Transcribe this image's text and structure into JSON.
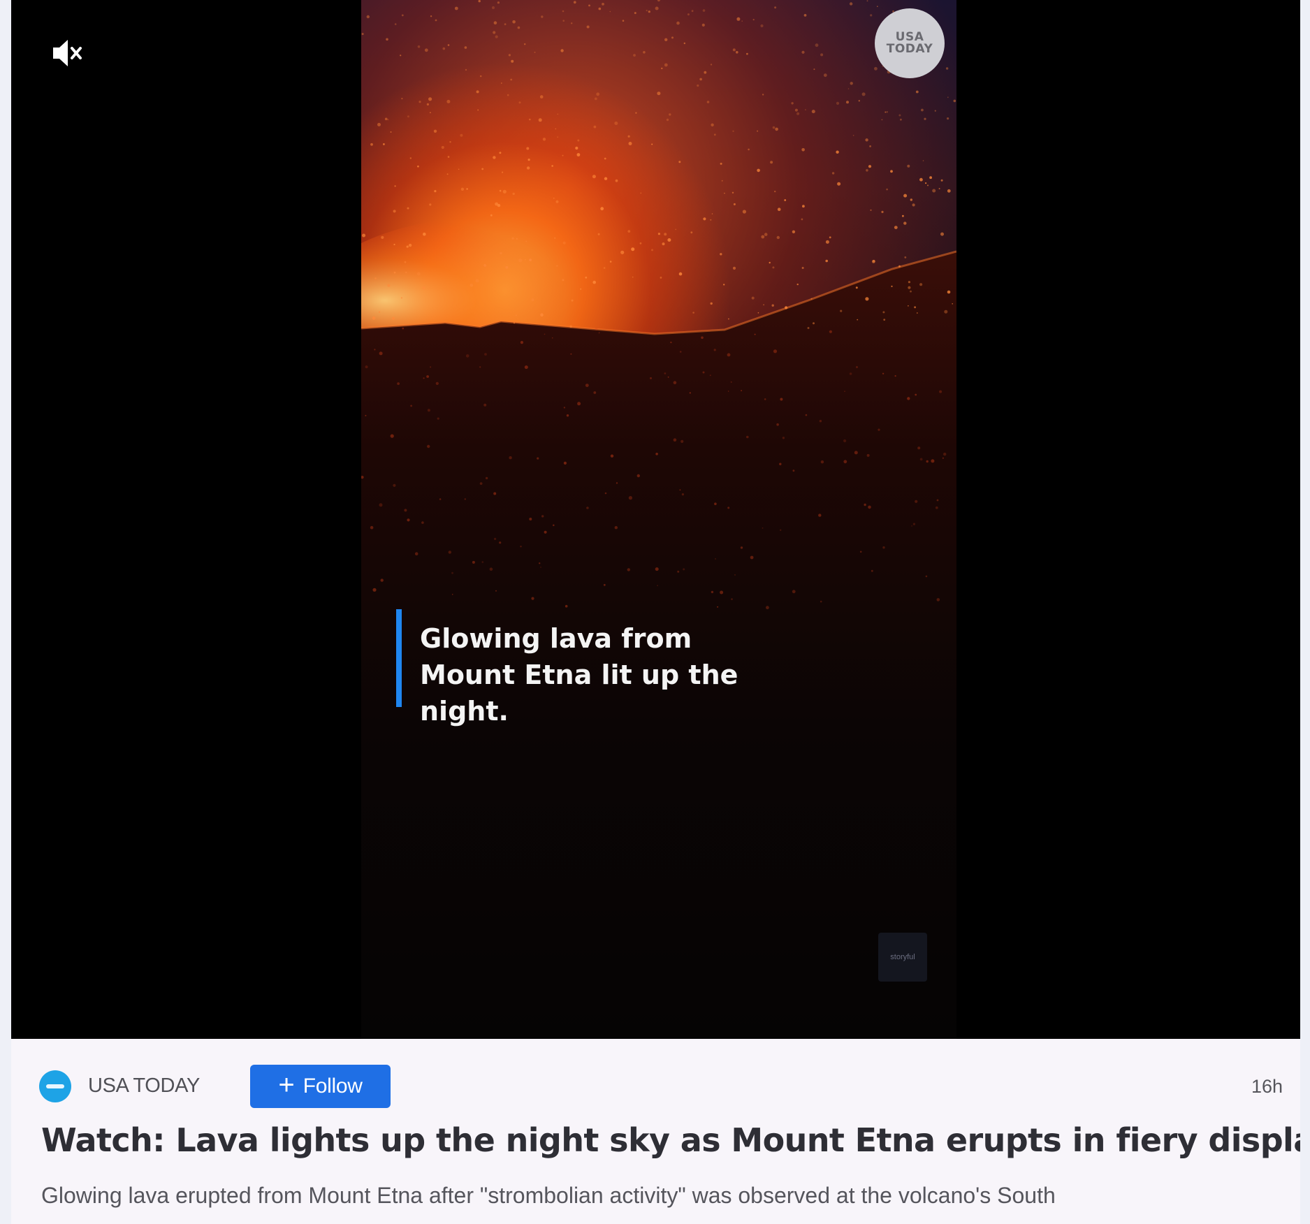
{
  "video": {
    "logo_text": "USA TODAY",
    "caption": "Glowing lava from Mount Etna lit up the night.",
    "watermark": "storyful",
    "mute_icon": "speaker-muted-icon"
  },
  "meta": {
    "publisher": "USA TODAY",
    "follow_label": "Follow",
    "follow_icon": "plus-icon",
    "timestamp": "16h"
  },
  "article": {
    "headline": "Watch: Lava lights up the night sky as Mount Etna erupts in fiery display",
    "summary": "Glowing lava erupted from Mount Etna after \"strombolian activity\" was observed at the volcano's South"
  },
  "colors": {
    "accent": "#1f6fe5",
    "caption_bar": "#1f86f0",
    "publisher_icon": "#1ea3e6"
  }
}
